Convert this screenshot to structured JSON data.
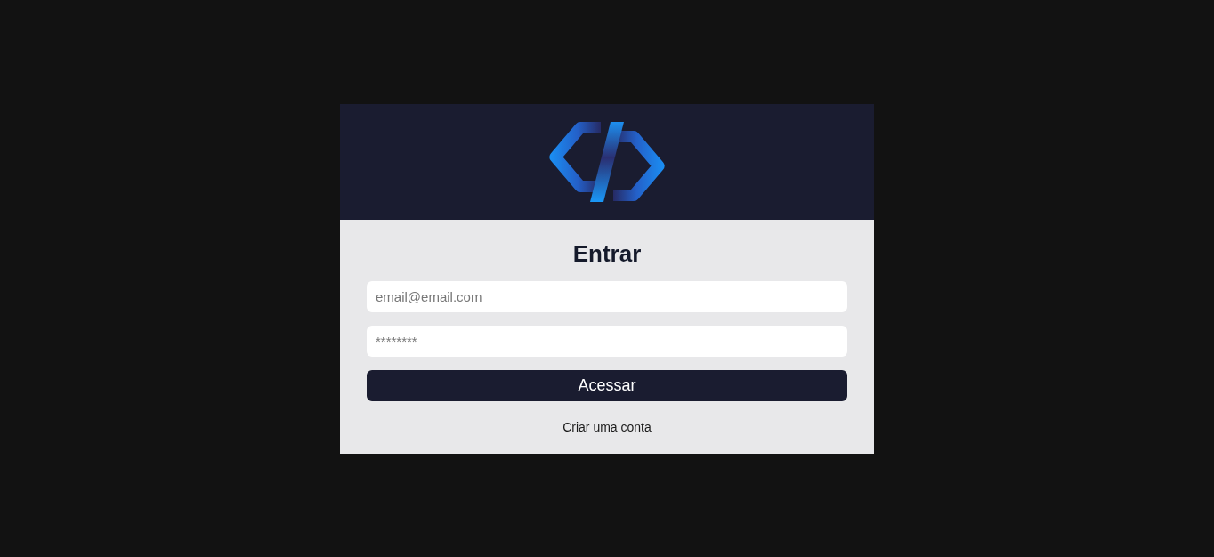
{
  "form": {
    "title": "Entrar",
    "fields": [
      {
        "placeholder": "email@email.com"
      },
      {
        "placeholder": "********"
      }
    ],
    "submit_button": "Acessar",
    "signup_link": "Criar uma conta"
  }
}
